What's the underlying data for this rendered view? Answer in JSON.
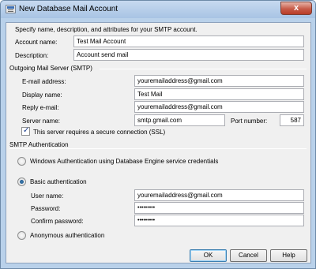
{
  "window": {
    "title": "New Database Mail Account",
    "close_glyph": "x"
  },
  "intro": "Specify name, description, and attributes for your SMTP account.",
  "account": {
    "name_label": "Account name:",
    "name_value": "Test Mail Account",
    "description_label": "Description:",
    "description_value": "Account send mail"
  },
  "smtp": {
    "section_title": "Outgoing Mail Server (SMTP)",
    "email_label": "E-mail address:",
    "email_value": "youremailaddress@gmail.com",
    "display_label": "Display name:",
    "display_value": "Test Mail",
    "reply_label": "Reply e-mail:",
    "reply_value": "youremailaddress@gmail.com",
    "server_label": "Server name:",
    "server_value": "smtp.gmail.com",
    "port_label": "Port number:",
    "port_value": "587",
    "ssl_label": "This server requires a secure connection (SSL)",
    "ssl_checked": true
  },
  "auth": {
    "section_title": "SMTP Authentication",
    "windows_label": "Windows Authentication using Database Engine service credentials",
    "basic_label": "Basic authentication",
    "selected": "basic",
    "username_label": "User name:",
    "username_value": "youremailaddress@gmail.com",
    "password_label": "Password:",
    "password_value": "•••••••••",
    "confirm_label": "Confirm password:",
    "confirm_value": "•••••••••",
    "anonymous_label": "Anonymous authentication"
  },
  "buttons": {
    "ok": "OK",
    "cancel": "Cancel",
    "help": "Help"
  },
  "icons": {
    "app_icon": "database-mail-icon",
    "close_icon": "close-icon",
    "check_glyph": "✓"
  }
}
